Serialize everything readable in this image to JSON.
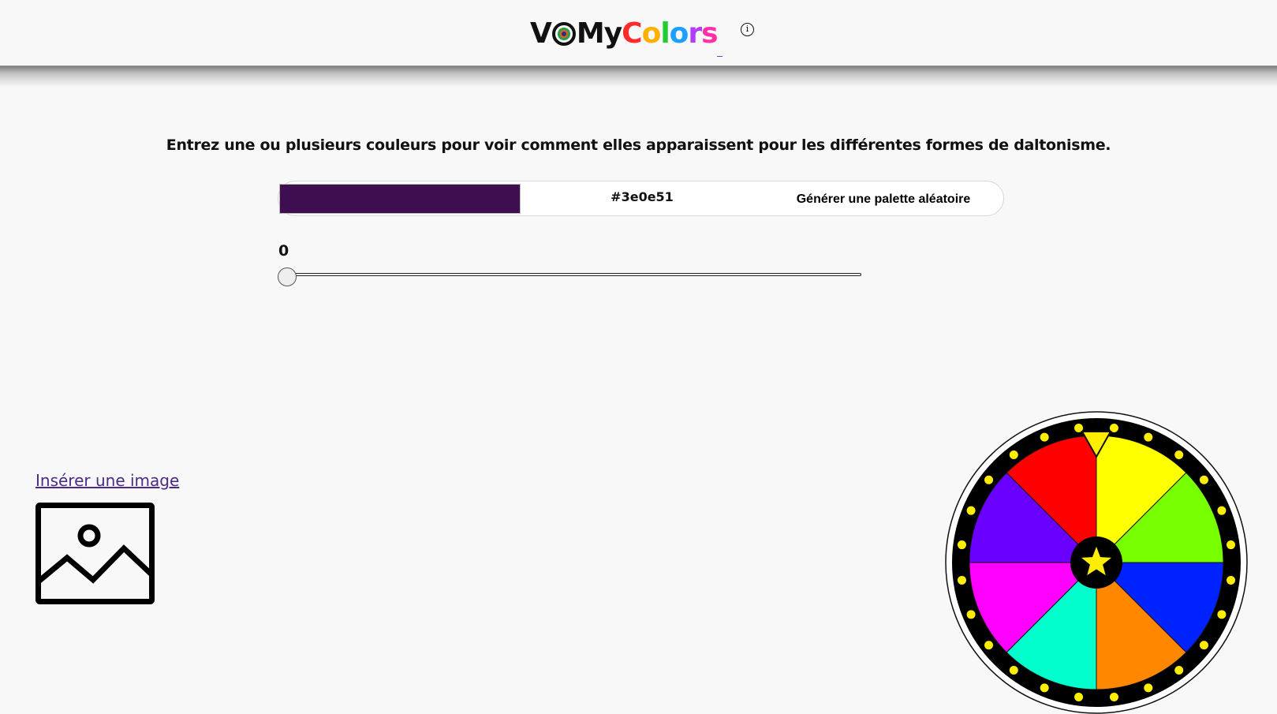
{
  "header": {
    "logo": {
      "prefix_v": "V",
      "mid_my": "My",
      "colors_letters": [
        "C",
        "o",
        "l",
        "o",
        "r",
        "s"
      ]
    },
    "info_glyph": "i"
  },
  "main": {
    "instruction": "Entrez une ou plusieurs couleurs pour voir comment elles apparaissent pour les différentes formes de daltonisme.",
    "color_input": {
      "swatch_color": "#3e0e51",
      "hex_value": "#3e0e51",
      "random_palette_label": "Générer une palette aléatoire"
    },
    "slider": {
      "value": "0",
      "level": 0
    }
  },
  "image_section": {
    "insert_label": "Insérer une image"
  },
  "wheel": {
    "segment_colors": [
      "#ffff00",
      "#77ff00",
      "#0022ff",
      "#ff8800",
      "#00ffcc",
      "#ff00ff",
      "#6a00ff",
      "#ff0000"
    ],
    "rim_color": "#000000",
    "dot_color": "#ffee00",
    "center_star_color": "#ffee00"
  }
}
